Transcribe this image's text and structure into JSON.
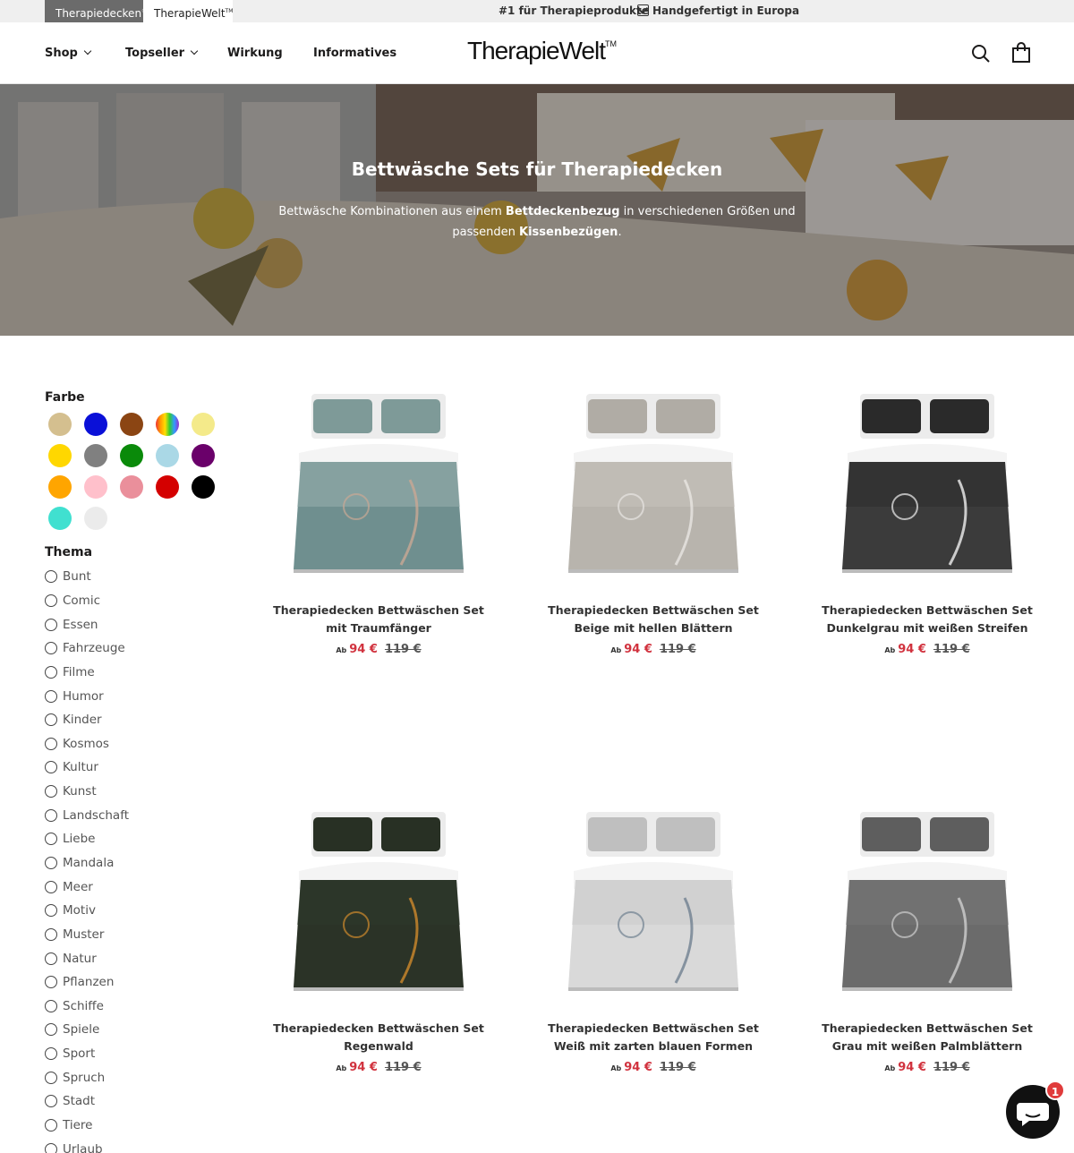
{
  "topbar": {
    "store_a": "Therapiedecken",
    "store_a_mark": "®",
    "store_b": "TherapieWelt",
    "store_b_mark": "TM",
    "message_1": "#1 für Therapieprodukte",
    "message_2": "Handgefertigt in Europa"
  },
  "header": {
    "nav": [
      "Shop",
      "Topseller",
      "Wirkung",
      "Informatives"
    ],
    "logo": "TherapieWelt",
    "logo_mark": "TM"
  },
  "hero": {
    "title": "Bettwäsche Sets für Therapiedecken",
    "desc_1": "Bettwäsche Kombinationen aus einem ",
    "desc_bold_1": "Bettdeckenbezug",
    "desc_2": " in verschiedenen Größen und passenden ",
    "desc_bold_2": "Kissenbezügen",
    "desc_3": "."
  },
  "filters": {
    "color_heading": "Farbe",
    "colors": [
      "#d4bf8f",
      "#0a10d8",
      "#8b4513",
      "rainbow",
      "#f4ea8a",
      "#ffd700",
      "#808080",
      "#0a8a0a",
      "#aad8e6",
      "#6a006a",
      "#ffa500",
      "#ffc0cb",
      "#ea8f9b",
      "#d40000",
      "#000000",
      "#40e0d0",
      "#ebebeb"
    ],
    "theme_heading": "Thema",
    "themes": [
      "Bunt",
      "Comic",
      "Essen",
      "Fahrzeuge",
      "Filme",
      "Humor",
      "Kinder",
      "Kosmos",
      "Kultur",
      "Kunst",
      "Landschaft",
      "Liebe",
      "Mandala",
      "Meer",
      "Motiv",
      "Muster",
      "Natur",
      "Pflanzen",
      "Schiffe",
      "Spiele",
      "Sport",
      "Spruch",
      "Stadt",
      "Tiere",
      "Urlaub"
    ]
  },
  "products": [
    {
      "title_1": "Therapiedecken Bettwäschen Set",
      "title_2": "mit Traumfänger",
      "ab": "Ab",
      "price": "94 €",
      "was": "119 €",
      "style": "dream"
    },
    {
      "title_1": "Therapiedecken Bettwäschen Set",
      "title_2": "Beige mit hellen Blättern",
      "ab": "Ab",
      "price": "94 €",
      "was": "119 €",
      "style": "beige"
    },
    {
      "title_1": "Therapiedecken Bettwäschen Set",
      "title_2": "Dunkelgrau mit weißen Streifen",
      "ab": "Ab",
      "price": "94 €",
      "was": "119 €",
      "style": "dark"
    },
    {
      "title_1": "Therapiedecken Bettwäschen Set",
      "title_2": "Regenwald",
      "ab": "Ab",
      "price": "94 €",
      "was": "119 €",
      "style": "jungle"
    },
    {
      "title_1": "Therapiedecken Bettwäschen Set",
      "title_2": "Weiß mit zarten blauen Formen",
      "ab": "Ab",
      "price": "94 €",
      "was": "119 €",
      "style": "pattern"
    },
    {
      "title_1": "Therapiedecken Bettwäschen Set",
      "title_2": "Grau mit weißen Palmblättern",
      "ab": "Ab",
      "price": "94 €",
      "was": "119 €",
      "style": "grey"
    }
  ],
  "chat": {
    "badge": "1"
  }
}
